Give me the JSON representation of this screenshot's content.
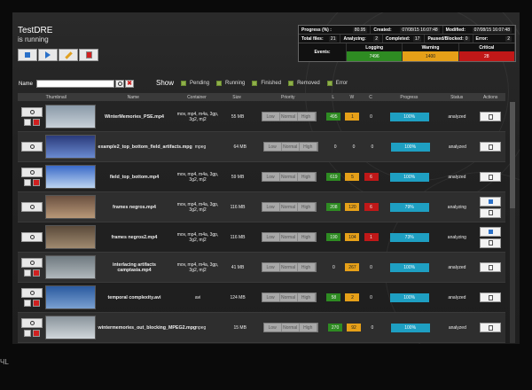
{
  "app": {
    "title": "TestDRE",
    "status": "is running"
  },
  "toolbar": [
    {
      "icon": "stop-icon"
    },
    {
      "icon": "play-icon"
    },
    {
      "icon": "edit-icon"
    },
    {
      "icon": "delete-icon"
    }
  ],
  "stats": {
    "progress_label": "Progress (%) :",
    "progress": "80.95",
    "created_label": "Created:",
    "created": "07/08/15 16:07:48",
    "modified_label": "Modified:",
    "modified": "07/08/15 16:07:48",
    "total_label": "Total files:",
    "total": "21",
    "analyzing_label": "Analyzing:",
    "analyzing": "2",
    "completed_label": "Completed:",
    "completed": "17",
    "paused_label": "Paused/Blocked:",
    "paused": "0",
    "error_label": "Error:",
    "error": "2",
    "events_label": "Events:",
    "logging_label": "Logging",
    "logging": "7496",
    "warning_label": "Warning",
    "warning": "1400",
    "critical_label": "Critical",
    "critical": "28"
  },
  "filter": {
    "name_label": "Name",
    "show_label": "Show",
    "items": [
      {
        "label": "Pending"
      },
      {
        "label": "Running"
      },
      {
        "label": "Finished"
      },
      {
        "label": "Removed"
      },
      {
        "label": "Error"
      }
    ]
  },
  "columns": [
    "Thumbnail",
    "Name",
    "Container",
    "Size",
    "Priority",
    "L",
    "W",
    "C",
    "Progress",
    "Status",
    "Actions"
  ],
  "priority": [
    "Low",
    "Normal",
    "High"
  ],
  "rows": [
    {
      "name": "WinterMemories_PSE.mp4",
      "container": "mov, mp4, m4a, 3gp, 3g2, mj2",
      "size": "55 MB",
      "l": "495",
      "w": "1",
      "c": "0",
      "progress": "100%",
      "status": "analyzed",
      "thumb": "#8a9aa8",
      "thumb2": "#c8d0d8",
      "actions": 1,
      "l_state": "g",
      "w_state": "o",
      "c_state": ""
    },
    {
      "name": "example2_top_bottom_field_artifacts.mpg",
      "container": "mpeg",
      "size": "64 MB",
      "l": "0",
      "w": "0",
      "c": "0",
      "progress": "100%",
      "status": "analyzed",
      "thumb": "#2a3a7a",
      "thumb2": "#6a8ad0",
      "actions": 1,
      "l_state": "",
      "w_state": "",
      "c_state": ""
    },
    {
      "name": "field_top_bottom.mp4",
      "container": "mov, mp4, m4a, 3gp, 3g2, mj2",
      "size": "59 MB",
      "l": "619",
      "w": "5",
      "c": "6",
      "progress": "100%",
      "status": "analyzed",
      "thumb": "#3a6ac8",
      "thumb2": "#bcd4f0",
      "actions": 1,
      "l_state": "g",
      "w_state": "o",
      "c_state": "r"
    },
    {
      "name": "frames negros.mp4",
      "container": "mov, mp4, m4a, 3gp, 3g2, mj2",
      "size": "116 MB",
      "l": "208",
      "w": "120",
      "c": "6",
      "progress": "79%",
      "status": "analyzing",
      "thumb": "#6a5040",
      "thumb2": "#b89878",
      "actions": 2,
      "l_state": "g",
      "w_state": "o",
      "c_state": "r"
    },
    {
      "name": "frames negros2.mp4",
      "container": "mov, mp4, m4a, 3gp, 3g2, mj2",
      "size": "116 MB",
      "l": "190",
      "w": "104",
      "c": "1",
      "progress": "73%",
      "status": "analyzing",
      "thumb": "#5a4a3a",
      "thumb2": "#a08a70",
      "actions": 2,
      "l_state": "g",
      "w_state": "o",
      "c_state": "r"
    },
    {
      "name": "interlacing artifacts camptasia.mp4",
      "container": "mov, mp4, m4a, 3gp, 3g2, mj2",
      "size": "41 MB",
      "l": "0",
      "w": "267",
      "c": "0",
      "progress": "100%",
      "status": "analyzed",
      "thumb": "#707a80",
      "thumb2": "#b0b8bc",
      "actions": 1,
      "l_state": "",
      "w_state": "o",
      "c_state": ""
    },
    {
      "name": "temporal complexity.avi",
      "container": "avi",
      "size": "124 MB",
      "l": "58",
      "w": "2",
      "c": "0",
      "progress": "100%",
      "status": "analyzed",
      "thumb": "#2a5aa0",
      "thumb2": "#7aa0d0",
      "actions": 1,
      "l_state": "g",
      "w_state": "o",
      "c_state": ""
    },
    {
      "name": "wintermemories_out_blocking_MPEG2.mpg",
      "container": "mpeg",
      "size": "15 MB",
      "l": "270",
      "w": "92",
      "c": "0",
      "progress": "100%",
      "status": "analyzed",
      "thumb": "#8a949c",
      "thumb2": "#d0d6da",
      "actions": 1,
      "l_state": "g",
      "w_state": "o",
      "c_state": ""
    }
  ],
  "watermark": "ЧL"
}
